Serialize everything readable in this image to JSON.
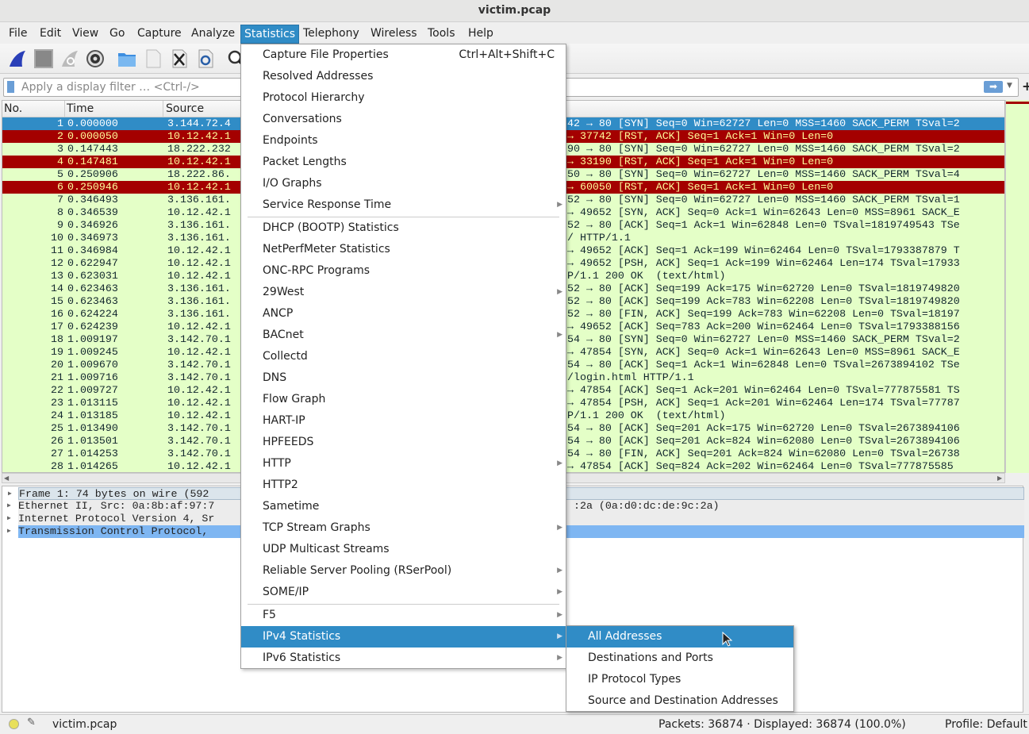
{
  "window": {
    "title": "victim.pcap"
  },
  "menubar": [
    "File",
    "Edit",
    "View",
    "Go",
    "Capture",
    "Analyze",
    "Statistics",
    "Telephony",
    "Wireless",
    "Tools",
    "Help"
  ],
  "menubar_active": "Statistics",
  "toolbar": {
    "icons": [
      "shark-fin-start-icon",
      "stop-icon",
      "restart-icon",
      "options-gear-icon",
      "open-folder-icon",
      "file-icon",
      "close-file-icon",
      "reload-file-icon",
      "search-icon"
    ]
  },
  "filter": {
    "placeholder": "Apply a display filter … <Ctrl-/>",
    "value": ""
  },
  "packet_list": {
    "columns": [
      "No.",
      "Time",
      "Source"
    ],
    "rows": [
      [
        "1",
        "0.000000",
        "3.144.72.4",
        "42 → 80 [SYN] Seq=0 Win=62727 Len=0 MSS=1460 SACK_PERM TSval=2",
        "sel"
      ],
      [
        "2",
        "0.000050",
        "10.12.42.1",
        "→ 37742 [RST, ACK] Seq=1 Ack=1 Win=0 Len=0",
        "rst"
      ],
      [
        "3",
        "0.147443",
        "18.222.232",
        "90 → 80 [SYN] Seq=0 Win=62727 Len=0 MSS=1460 SACK_PERM TSval=2",
        "ok"
      ],
      [
        "4",
        "0.147481",
        "10.12.42.1",
        "→ 33190 [RST, ACK] Seq=1 Ack=1 Win=0 Len=0",
        "rst"
      ],
      [
        "5",
        "0.250906",
        "18.222.86.",
        "50 → 80 [SYN] Seq=0 Win=62727 Len=0 MSS=1460 SACK_PERM TSval=4",
        "ok"
      ],
      [
        "6",
        "0.250946",
        "10.12.42.1",
        "→ 60050 [RST, ACK] Seq=1 Ack=1 Win=0 Len=0",
        "rst"
      ],
      [
        "7",
        "0.346493",
        "3.136.161.",
        "52 → 80 [SYN] Seq=0 Win=62727 Len=0 MSS=1460 SACK_PERM TSval=1",
        "ok"
      ],
      [
        "8",
        "0.346539",
        "10.12.42.1",
        "→ 49652 [SYN, ACK] Seq=0 Ack=1 Win=62643 Len=0 MSS=8961 SACK_E",
        "ok"
      ],
      [
        "9",
        "0.346926",
        "3.136.161.",
        "52 → 80 [ACK] Seq=1 Ack=1 Win=62848 Len=0 TSval=1819749543 TSe",
        "ok"
      ],
      [
        "10",
        "0.346973",
        "3.136.161.",
        "/ HTTP/1.1",
        "ok"
      ],
      [
        "11",
        "0.346984",
        "10.12.42.1",
        "→ 49652 [ACK] Seq=1 Ack=199 Win=62464 Len=0 TSval=1793387879 T",
        "ok"
      ],
      [
        "12",
        "0.622947",
        "10.12.42.1",
        "→ 49652 [PSH, ACK] Seq=1 Ack=199 Win=62464 Len=174 TSval=17933",
        "ok"
      ],
      [
        "13",
        "0.623031",
        "10.12.42.1",
        "P/1.1 200 OK  (text/html)",
        "ok"
      ],
      [
        "14",
        "0.623463",
        "3.136.161.",
        "52 → 80 [ACK] Seq=199 Ack=175 Win=62720 Len=0 TSval=1819749820",
        "ok"
      ],
      [
        "15",
        "0.623463",
        "3.136.161.",
        "52 → 80 [ACK] Seq=199 Ack=783 Win=62208 Len=0 TSval=1819749820",
        "ok"
      ],
      [
        "16",
        "0.624224",
        "3.136.161.",
        "52 → 80 [FIN, ACK] Seq=199 Ack=783 Win=62208 Len=0 TSval=18197",
        "ok"
      ],
      [
        "17",
        "0.624239",
        "10.12.42.1",
        "→ 49652 [ACK] Seq=783 Ack=200 Win=62464 Len=0 TSval=1793388156",
        "ok"
      ],
      [
        "18",
        "1.009197",
        "3.142.70.1",
        "54 → 80 [SYN] Seq=0 Win=62727 Len=0 MSS=1460 SACK_PERM TSval=2",
        "ok"
      ],
      [
        "19",
        "1.009245",
        "10.12.42.1",
        "→ 47854 [SYN, ACK] Seq=0 Ack=1 Win=62643 Len=0 MSS=8961 SACK_E",
        "ok"
      ],
      [
        "20",
        "1.009670",
        "3.142.70.1",
        "54 → 80 [ACK] Seq=1 Ack=1 Win=62848 Len=0 TSval=2673894102 TSe",
        "ok"
      ],
      [
        "21",
        "1.009716",
        "3.142.70.1",
        "/login.html HTTP/1.1",
        "ok"
      ],
      [
        "22",
        "1.009727",
        "10.12.42.1",
        "→ 47854 [ACK] Seq=1 Ack=201 Win=62464 Len=0 TSval=777875581 TS",
        "ok"
      ],
      [
        "23",
        "1.013115",
        "10.12.42.1",
        "→ 47854 [PSH, ACK] Seq=1 Ack=201 Win=62464 Len=174 TSval=77787",
        "ok"
      ],
      [
        "24",
        "1.013185",
        "10.12.42.1",
        "P/1.1 200 OK  (text/html)",
        "ok"
      ],
      [
        "25",
        "1.013490",
        "3.142.70.1",
        "54 → 80 [ACK] Seq=201 Ack=175 Win=62720 Len=0 TSval=2673894106",
        "ok"
      ],
      [
        "26",
        "1.013501",
        "3.142.70.1",
        "54 → 80 [ACK] Seq=201 Ack=824 Win=62080 Len=0 TSval=2673894106",
        "ok"
      ],
      [
        "27",
        "1.014253",
        "3.142.70.1",
        "54 → 80 [FIN, ACK] Seq=201 Ack=824 Win=62080 Len=0 TSval=26738",
        "ok"
      ],
      [
        "28",
        "1.014265",
        "10.12.42.1",
        "→ 47854 [ACK] Seq=824 Ack=202 Win=62464 Len=0 TSval=777875585",
        "ok"
      ]
    ]
  },
  "details": [
    {
      "left": "Frame 1: 74 bytes on wire (592",
      "right": ""
    },
    {
      "left": "Ethernet II, Src: 0a:8b:af:97:7",
      "right": ":2a (0a:d0:dc:de:9c:2a)"
    },
    {
      "left": "Internet Protocol Version 4, Sr",
      "right": ""
    },
    {
      "left": "Transmission Control Protocol,",
      "right": ""
    }
  ],
  "statistics_menu": [
    {
      "label": "Capture File Properties",
      "shortcut": "Ctrl+Alt+Shift+C"
    },
    {
      "label": "Resolved Addresses"
    },
    {
      "label": "Protocol Hierarchy"
    },
    {
      "label": "Conversations"
    },
    {
      "label": "Endpoints"
    },
    {
      "label": "Packet Lengths"
    },
    {
      "label": "I/O Graphs"
    },
    {
      "label": "Service Response Time",
      "submenu": true,
      "sep_after": true
    },
    {
      "label": "DHCP (BOOTP) Statistics"
    },
    {
      "label": "NetPerfMeter Statistics"
    },
    {
      "label": "ONC-RPC Programs"
    },
    {
      "label": "29West",
      "submenu": true
    },
    {
      "label": "ANCP"
    },
    {
      "label": "BACnet",
      "submenu": true
    },
    {
      "label": "Collectd"
    },
    {
      "label": "DNS"
    },
    {
      "label": "Flow Graph"
    },
    {
      "label": "HART-IP"
    },
    {
      "label": "HPFEEDS"
    },
    {
      "label": "HTTP",
      "submenu": true
    },
    {
      "label": "HTTP2"
    },
    {
      "label": "Sametime"
    },
    {
      "label": "TCP Stream Graphs",
      "submenu": true
    },
    {
      "label": "UDP Multicast Streams"
    },
    {
      "label": "Reliable Server Pooling (RSerPool)",
      "submenu": true
    },
    {
      "label": "SOME/IP",
      "submenu": true,
      "sep_after": true
    },
    {
      "label": "F5",
      "submenu": true
    },
    {
      "label": "IPv4 Statistics",
      "submenu": true,
      "highlighted": true
    },
    {
      "label": "IPv6 Statistics",
      "submenu": true
    }
  ],
  "ipv4_submenu": [
    {
      "label": "All Addresses",
      "highlighted": true
    },
    {
      "label": "Destinations and Ports"
    },
    {
      "label": "IP Protocol Types"
    },
    {
      "label": "Source and Destination Addresses"
    }
  ],
  "statusbar": {
    "file": "victim.pcap",
    "packets": "Packets: 36874 · Displayed: 36874 (100.0%)",
    "profile": "Profile: Default"
  },
  "colors": {
    "selected": "#308cc6",
    "rst_bg": "#a40000",
    "rst_fg": "#fffc9c",
    "tcp_bg": "#e4ffc7"
  }
}
